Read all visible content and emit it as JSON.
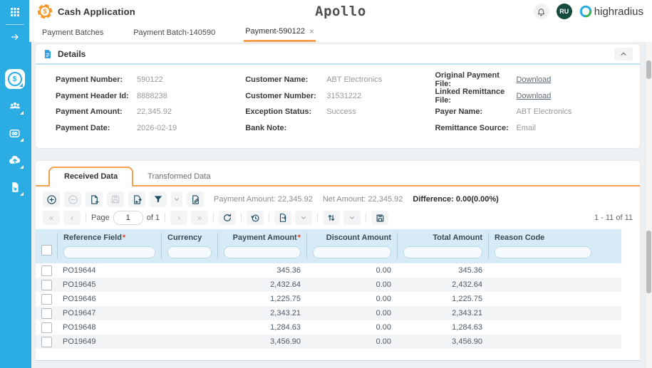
{
  "header": {
    "app_title": "Cash Application",
    "logo_text": "Apollo",
    "brand_name": "highradius",
    "avatar": "RU"
  },
  "glyphs": {
    "dollar": "$",
    "close": "×",
    "first": "«",
    "prev": "‹",
    "next": "›",
    "last": "»"
  },
  "icons": {
    "sidebar": [
      "apps-grid",
      "expand",
      "cash-app-coin",
      "customers",
      "linked-payments",
      "cloud-upload",
      "documents"
    ],
    "toolbar": [
      "add-row",
      "remove-row",
      "add-file",
      "save",
      "update-file",
      "filter",
      "edit-file"
    ],
    "pagination": [
      "first-page",
      "previous-page",
      "next-page",
      "last-page",
      "refresh",
      "history",
      "export",
      "sort",
      "save-layout"
    ],
    "header_icons": [
      "notification-bell",
      "brand-logo"
    ],
    "details_icons": [
      "document",
      "collapse-chevron-up"
    ]
  },
  "colors": {
    "sidebar_blue": "#2BACE2",
    "accent_orange": "#F5A051",
    "table_header_blue": "#D7EBF7",
    "icon_navy": "#1B4A5E",
    "brand_green": "#3BB54A",
    "logo_orange": "#F7941E",
    "avatar_green": "#14493E",
    "required_red": "#E03C31"
  },
  "nav_tabs": [
    {
      "label": "Payment Batches"
    },
    {
      "label": "Payment Batch-140590"
    },
    {
      "label": "Payment-590122"
    }
  ],
  "details": {
    "title": "Details",
    "fields": [
      {
        "label": "Payment Number:",
        "value": "590122"
      },
      {
        "label": "Payment Header Id:",
        "value": "8888238"
      },
      {
        "label": "Payment Amount:",
        "value": "22,345.92"
      },
      {
        "label": "Payment Date:",
        "value": "2026-02-19"
      },
      {
        "label": "Customer Name:",
        "value": "ABT Electronics"
      },
      {
        "label": "Customer Number:",
        "value": "31531222"
      },
      {
        "label": "Exception Status:",
        "value": "Success"
      },
      {
        "label": "Bank Note:",
        "value": ""
      },
      {
        "label": "Original Payment File:",
        "value": "Download"
      },
      {
        "label": "Linked Remittance File:",
        "value": "Download"
      },
      {
        "label": "Payer Name:",
        "value": "ABT Electronics"
      },
      {
        "label": "Remittance Source:",
        "value": "Email"
      }
    ]
  },
  "data_tabs": [
    {
      "label": "Received Data"
    },
    {
      "label": "Transformed Data"
    }
  ],
  "summary": {
    "payment_amount_label": "Payment Amount:",
    "payment_amount": "22,345.92",
    "net_amount_label": "Net Amount:",
    "net_amount": "22,345.92",
    "difference_label": "Difference:",
    "difference": "0.00(0.00%)"
  },
  "pagination": {
    "page_label": "Page",
    "page_value": "1",
    "of_label": "of 1",
    "range_label": "1 - 11 of 11"
  },
  "table": {
    "required_mark": "*",
    "columns": [
      {
        "label": "Reference Field",
        "required": true,
        "align": "left"
      },
      {
        "label": "Currency",
        "required": false,
        "align": "left"
      },
      {
        "label": "Payment Amount",
        "required": true,
        "align": "right"
      },
      {
        "label": "Discount Amount",
        "required": false,
        "align": "right"
      },
      {
        "label": "Total Amount",
        "required": false,
        "align": "right"
      },
      {
        "label": "Reason Code",
        "required": false,
        "align": "left"
      }
    ],
    "rows": [
      {
        "reference": "PO19644",
        "currency": "",
        "payment_amount": "345.36",
        "discount_amount": "0.00",
        "total_amount": "345.36",
        "reason_code": ""
      },
      {
        "reference": "PO19645",
        "currency": "",
        "payment_amount": "2,432.64",
        "discount_amount": "0.00",
        "total_amount": "2,432.64",
        "reason_code": ""
      },
      {
        "reference": "PO19646",
        "currency": "",
        "payment_amount": "1,225.75",
        "discount_amount": "0.00",
        "total_amount": "1,225.75",
        "reason_code": ""
      },
      {
        "reference": "PO19647",
        "currency": "",
        "payment_amount": "2,343.21",
        "discount_amount": "0.00",
        "total_amount": "2,343.21",
        "reason_code": ""
      },
      {
        "reference": "PO19648",
        "currency": "",
        "payment_amount": "1,284.63",
        "discount_amount": "0.00",
        "total_amount": "1,284.63",
        "reason_code": ""
      },
      {
        "reference": "PO19649",
        "currency": "",
        "payment_amount": "3,456.90",
        "discount_amount": "0.00",
        "total_amount": "3,456.90",
        "reason_code": ""
      }
    ]
  }
}
